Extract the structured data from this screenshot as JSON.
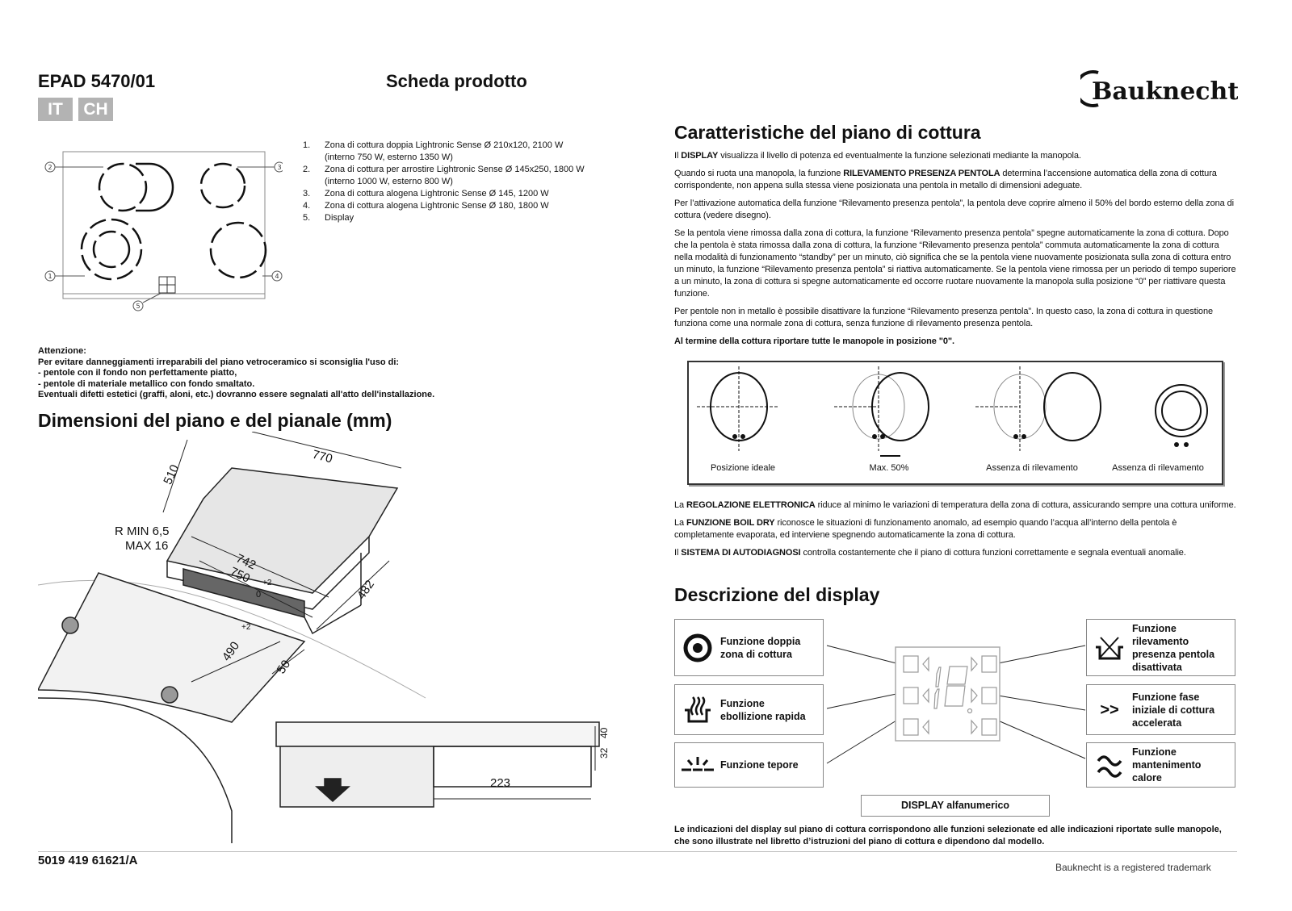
{
  "header": {
    "model": "EPAD 5470/01",
    "doc_type": "Scheda prodotto",
    "countries": [
      "IT",
      "CH"
    ],
    "brand": "Bauknecht"
  },
  "hob": {
    "callouts": [
      "1",
      "2",
      "3",
      "4",
      "5"
    ],
    "list": [
      {
        "n": "1.",
        "text": "Zona di cottura doppia Lightronic Sense Ø 210x120, 2100 W (interno 750 W, esterno 1350 W)"
      },
      {
        "n": "2.",
        "text": "Zona di cottura per arrostire Lightronic Sense Ø 145x250, 1800 W (interno 1000 W, esterno 800 W)"
      },
      {
        "n": "3.",
        "text": "Zona di cottura alogena Lightronic Sense Ø 145, 1200 W"
      },
      {
        "n": "4.",
        "text": "Zona di cottura alogena Lightronic Sense Ø 180, 1800 W"
      },
      {
        "n": "5.",
        "text": "Display"
      }
    ]
  },
  "warning": {
    "lines": [
      "Attenzione:",
      "Per evitare danneggiamenti irreparabili del piano vetroceramico si sconsiglia l'uso di:",
      "- pentole con il fondo non perfettamente piatto,",
      "- pentole di materiale metallico con fondo smaltato.",
      "Eventuali difetti estetici (graffi, aloni, etc.) dovranno essere segnalati all'atto dell'installazione."
    ]
  },
  "dimensions": {
    "title": "Dimensioni del piano e del pianale (mm)",
    "labels": {
      "depth": "510",
      "width": "770",
      "cut_width": "742",
      "cut_width_tol": "750",
      "tol": "+2",
      "tol0": "0",
      "height": "482",
      "cut_depth": "490",
      "edge": "50",
      "radius": "R MIN 6,5",
      "radius_max": "MAX 16",
      "side": "223",
      "h1": "32",
      "h2": "40"
    }
  },
  "features": {
    "title": "Caratteristiche del piano di cottura",
    "paragraphs": [
      {
        "pre": "Il ",
        "b": "DISPLAY",
        "post": " visualizza il livello di potenza ed eventualmente la funzione selezionati mediante la manopola."
      },
      {
        "pre": "Quando si ruota una manopola, la funzione ",
        "b": "RILEVAMENTO PRESENZA PENTOLA",
        "post": " determina l’accensione automatica della zona di cottura corrispondente, non appena sulla stessa viene posizionata una pentola in metallo di dimensioni adeguate."
      },
      {
        "pre": "Per l’attivazione automatica della funzione “Rilevamento presenza pentola”, la pentola deve coprire almeno il 50% del bordo esterno della zona di cottura (vedere disegno).",
        "b": "",
        "post": ""
      },
      {
        "pre": "Se la pentola viene rimossa dalla zona di cottura, la funzione “Rilevamento presenza pentola” spegne automaticamente la zona di cottura. Dopo che la pentola è stata rimossa dalla zona di cottura, la funzione “Rilevamento presenza pentola” commuta automaticamente la zona di cottura nella modalità di funzionamento “standby” per un minuto, ciò significa che se la pentola viene nuovamente posizionata sulla zona di cottura entro un minuto, la funzione “Rilevamento presenza pentola” si riattiva automaticamente. Se la pentola viene rimossa per un periodo di tempo superiore a un minuto, la zona di cottura si spegne automaticamente ed occorre ruotare nuovamente la manopola sulla posizione “0” per riattivare questa funzione.",
        "b": "",
        "post": ""
      },
      {
        "pre": "Per pentole non in metallo è possibile disattivare la funzione “Rilevamento presenza pentola”. In questo caso, la zona di cottura in questione funziona come una normale zona di cottura, senza funzione di rilevamento presenza pentola.",
        "b": "",
        "post": ""
      }
    ],
    "note": "Al termine della cottura riportare tutte le manopole in posizione \"0\".",
    "diagram_captions": [
      "Posizione ideale",
      "Max. 50%",
      "Assenza di rilevamento",
      "Assenza di rilevamento"
    ],
    "paragraphs2": [
      {
        "pre": "La ",
        "b": "REGOLAZIONE ELETTRONICA",
        "post": " riduce al minimo le variazioni di temperatura della zona di cottura, assicurando sempre una cottura uniforme."
      },
      {
        "pre": "La ",
        "b": "FUNZIONE BOIL DRY",
        "post": " riconosce le situazioni di funzionamento anomalo, ad esempio quando l’acqua all’interno della pentola è completamente evaporata, ed interviene spegnendo automaticamente la zona di cottura."
      },
      {
        "pre": "Il ",
        "b": "SISTEMA DI AUTODIAGNOSI",
        "post": " controlla costantemente che il piano di cottura funzioni correttamente e segnala eventuali anomalie."
      }
    ]
  },
  "display": {
    "title": "Descrizione del display",
    "left": [
      {
        "icon": "double-zone-icon",
        "label": "Funzione doppia zona di cottura"
      },
      {
        "icon": "rapid-boil-icon",
        "label": "Funzione ebollizione rapida"
      },
      {
        "icon": "warm-icon",
        "label": "Funzione tepore"
      }
    ],
    "right": [
      {
        "icon": "pan-detection-off-icon",
        "label": "Funzione rilevamento presenza pentola disattivata"
      },
      {
        "icon": "fast-start-icon",
        "label": "Funzione fase iniziale di cottura accelerata"
      },
      {
        "icon": "keep-warm-icon",
        "label": "Funzione mantenimento calore"
      }
    ],
    "center_label": "DISPLAY alfanumerico",
    "note": "Le indicazioni del display sul piano di cottura corrispondono alle funzioni selezionate ed alle indicazioni riportate sulle manopole, che sono illustrate nel libretto d’istruzioni del piano di cottura e dipendono dal modello."
  },
  "footer": {
    "code": "5019 419 61621/A",
    "trademark": "Bauknecht is a registered trademark"
  }
}
